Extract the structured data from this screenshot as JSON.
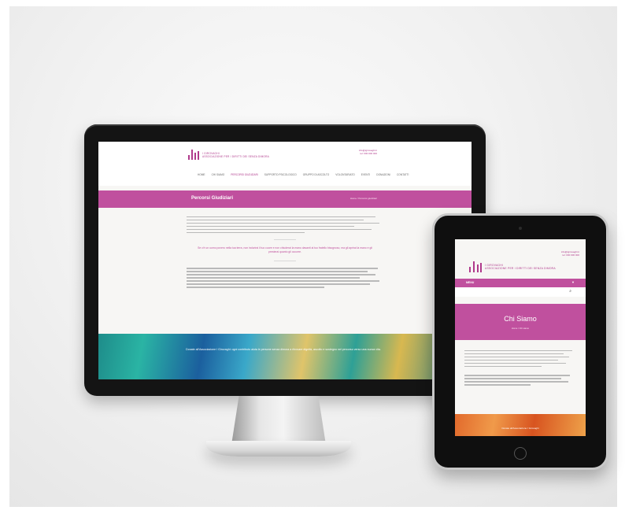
{
  "desktop": {
    "logo_text_line1": "I GIROVAGHI",
    "logo_text_line2": "ASSOCIAZIONE PER I DIRITTI DEI SENZA DIMORA",
    "contact_line1": "info@igirovaghi.it",
    "contact_line2": "tel: 000 000 000",
    "nav": [
      "Home",
      "Chi siamo",
      "Percorsi giudiziari",
      "Supporto psicologico",
      "Gruppo di ascolto",
      "Volontariato",
      "Eventi",
      "Donazioni",
      "Contatti"
    ],
    "nav_active_index": 2,
    "page_title": "Percorsi Giudiziari",
    "breadcrumb": "Home / Percorsi giudiziari",
    "quote": "Se c'è un uomo povero nella tua terra, non indurirai il tuo cuore e non chiuderai la mano davanti al tuo fratello bisognoso, ma gli aprirai la mano e gli presterai quanto gli occorre.",
    "footer_text": "Donate all'Associazione I Girovaghi: ogni contributo aiuta le persone senza dimora a ritrovare dignità, ascolto e sostegno nel percorso verso una nuova vita."
  },
  "tablet": {
    "contact_line1": "info@igirovaghi.it",
    "contact_line2": "tel: 000 000 000",
    "logo_text_line1": "I GIROVAGHI",
    "logo_text_line2": "ASSOCIAZIONE PER I DIRITTI DEI SENZA DIMORA",
    "menu_label": "MENU",
    "menu_arrow": "▼",
    "page_title": "Chi Siamo",
    "breadcrumb": "Home / Chi siamo",
    "footer_text": "Donate all'Associazione I Girovaghi"
  },
  "colors": {
    "brand": "#c0509e",
    "background": "#f2f2f2"
  }
}
